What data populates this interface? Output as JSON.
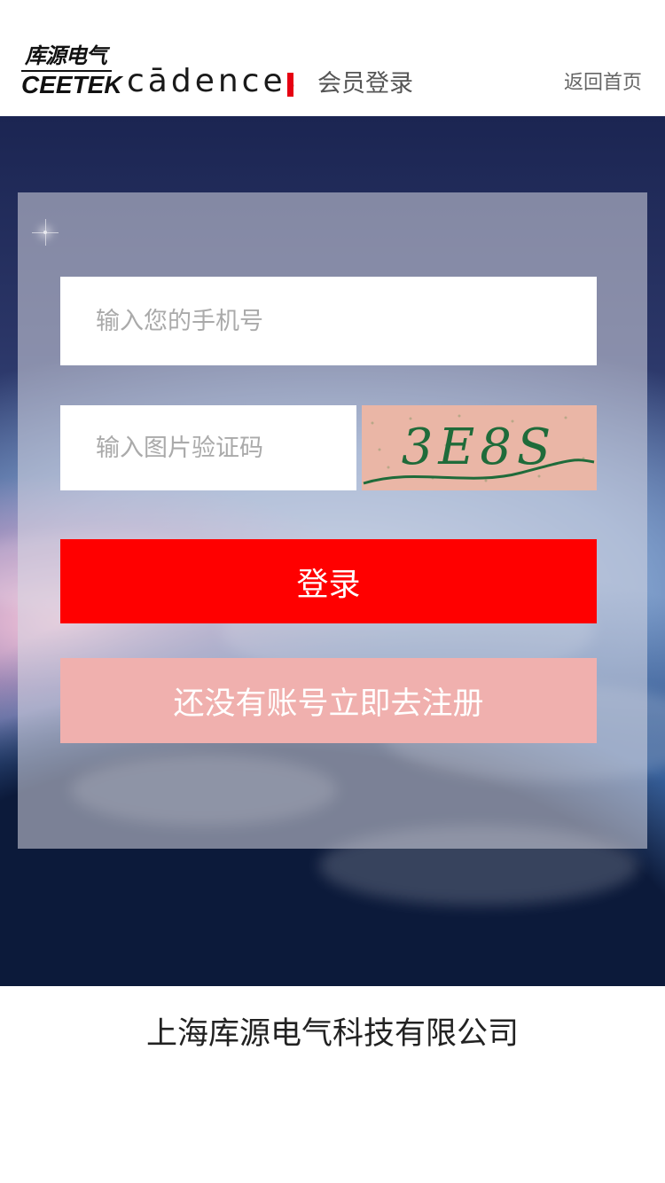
{
  "header": {
    "logo_cn": "库源电气",
    "logo_en": "CEETEK",
    "partner_logo": "cādence",
    "partner_logo_mark": "®",
    "page_title": "会员登录",
    "back_home_label": "返回首页",
    "accent_color": "#e60012"
  },
  "login_form": {
    "phone_placeholder": "输入您的手机号",
    "phone_value": "",
    "captcha_placeholder": "输入图片验证码",
    "captcha_value": "",
    "captcha_image_text": "3E8S",
    "login_button_label": "登录",
    "register_button_label": "还没有账号立即去注册",
    "login_button_color": "#ff0000",
    "register_button_color": "#f0b0ae"
  },
  "footer": {
    "company_name": "上海库源电气科技有限公司"
  }
}
